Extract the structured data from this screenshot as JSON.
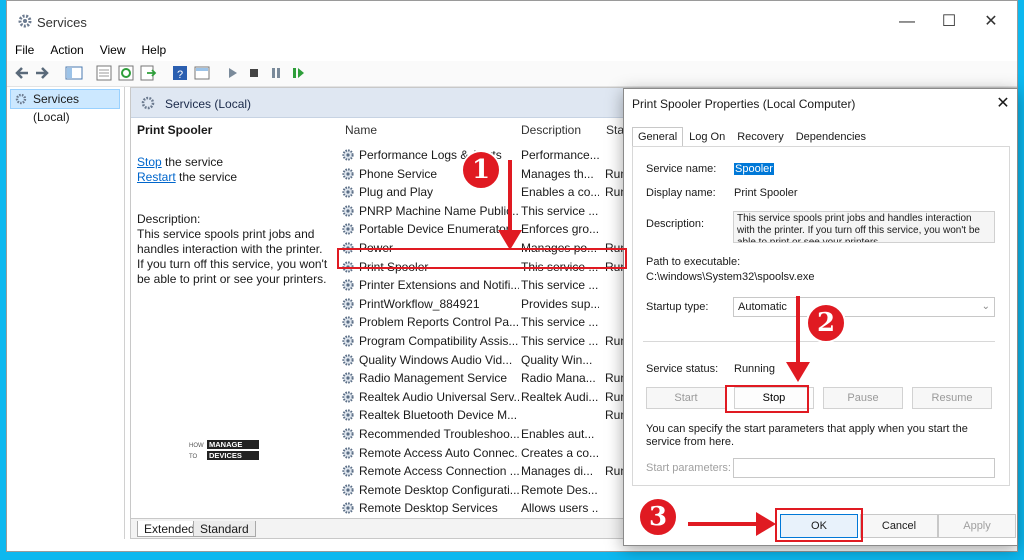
{
  "window": {
    "title": "Services",
    "controls": {
      "minimize": "—",
      "maximize": "☐",
      "close": "✕"
    }
  },
  "menu": [
    "File",
    "Action",
    "View",
    "Help"
  ],
  "tree": {
    "item": "Services (Local)"
  },
  "main_header": "Services (Local)",
  "detail": {
    "service_name": "Print Spooler",
    "stop_link": "Stop",
    "stop_suffix": " the service",
    "restart_link": "Restart",
    "restart_suffix": " the service",
    "description_label": "Description:",
    "description_text": "This service spools print jobs and handles interaction with the printer. If you turn off this service, you won't be able to print or see your printers."
  },
  "columns": {
    "name": "Name",
    "description": "Description",
    "status": "Stat"
  },
  "services": [
    {
      "name": "Performance Logs & Alerts",
      "desc": "Performance...",
      "status": ""
    },
    {
      "name": "Phone Service",
      "desc": "Manages th...",
      "status": "Run"
    },
    {
      "name": "Plug and Play",
      "desc": "Enables a co...",
      "status": "Run"
    },
    {
      "name": "PNRP Machine Name Public...",
      "desc": "This service ...",
      "status": ""
    },
    {
      "name": "Portable Device Enumerator ...",
      "desc": "Enforces gro...",
      "status": ""
    },
    {
      "name": "Power",
      "desc": "Manages po...",
      "status": "Run"
    },
    {
      "name": "Print Spooler",
      "desc": "This service ...",
      "status": "Run"
    },
    {
      "name": "Printer Extensions and Notifi...",
      "desc": "This service ...",
      "status": ""
    },
    {
      "name": "PrintWorkflow_884921",
      "desc": "Provides sup...",
      "status": ""
    },
    {
      "name": "Problem Reports Control Pa...",
      "desc": "This service ...",
      "status": ""
    },
    {
      "name": "Program Compatibility Assis...",
      "desc": "This service ...",
      "status": "Run"
    },
    {
      "name": "Quality Windows Audio Vid...",
      "desc": "Quality Win...",
      "status": ""
    },
    {
      "name": "Radio Management Service",
      "desc": "Radio Mana...",
      "status": "Run"
    },
    {
      "name": "Realtek Audio Universal Serv...",
      "desc": "Realtek Audi...",
      "status": "Run"
    },
    {
      "name": "Realtek Bluetooth Device M...",
      "desc": "",
      "status": "Run"
    },
    {
      "name": "Recommended Troubleshoo...",
      "desc": "Enables aut...",
      "status": ""
    },
    {
      "name": "Remote Access Auto Connec...",
      "desc": "Creates a co...",
      "status": ""
    },
    {
      "name": "Remote Access Connection ...",
      "desc": "Manages di...",
      "status": "Run"
    },
    {
      "name": "Remote Desktop Configurati...",
      "desc": "Remote Des...",
      "status": ""
    },
    {
      "name": "Remote Desktop Services",
      "desc": "Allows users ...",
      "status": ""
    }
  ],
  "bottom_tabs": [
    "Extended",
    "Standard"
  ],
  "logo": {
    "line1": "HOW",
    "line2": "TO",
    "word1": "MANAGE",
    "word2": "DEVICES"
  },
  "dialog": {
    "title": "Print Spooler Properties (Local Computer)",
    "tabs": [
      "General",
      "Log On",
      "Recovery",
      "Dependencies"
    ],
    "service_name_label": "Service name:",
    "service_name_value": "Spooler",
    "display_name_label": "Display name:",
    "display_name_value": "Print Spooler",
    "description_label": "Description:",
    "description_value": "This service spools print jobs and handles interaction with the printer.  If you turn off this service, you won't be able to print or see your printers.",
    "path_label": "Path to executable:",
    "path_value": "C:\\windows\\System32\\spoolsv.exe",
    "startup_label": "Startup type:",
    "startup_value": "Automatic",
    "status_label": "Service status:",
    "status_value": "Running",
    "buttons": {
      "start": "Start",
      "stop": "Stop",
      "pause": "Pause",
      "resume": "Resume"
    },
    "hint": "You can specify the start parameters that apply when you start the service from here.",
    "start_params_label": "Start parameters:",
    "footer": {
      "ok": "OK",
      "cancel": "Cancel",
      "apply": "Apply"
    }
  },
  "annotations": {
    "one": "1",
    "two": "2",
    "three": "3"
  },
  "colors": {
    "accent_red": "#e01a22",
    "frame_blue": "#0db8ef",
    "selection_blue": "#0078d7"
  }
}
